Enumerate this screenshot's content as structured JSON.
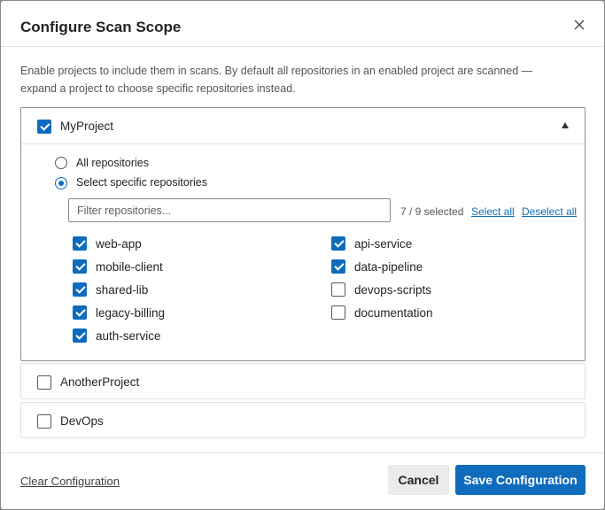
{
  "dialog": {
    "title": "Configure Scan Scope",
    "description": "Enable projects to include them in scans. By default all repositories in an enabled project are scanned — expand a project to choose specific repositories instead."
  },
  "projects": [
    {
      "name": "MyProject",
      "checked": true,
      "expanded": true,
      "scope_options": {
        "all_label": "All repositories",
        "specific_label": "Select specific repositories",
        "selected": "specific"
      },
      "filter_placeholder": "Filter repositories...",
      "selected_count": "7 / 9 selected",
      "select_all_label": "Select all",
      "deselect_all_label": "Deselect all",
      "repositories": [
        {
          "name": "web-app",
          "checked": true
        },
        {
          "name": "api-service",
          "checked": true
        },
        {
          "name": "mobile-client",
          "checked": true
        },
        {
          "name": "data-pipeline",
          "checked": true
        },
        {
          "name": "shared-lib",
          "checked": true
        },
        {
          "name": "devops-scripts",
          "checked": false
        },
        {
          "name": "legacy-billing",
          "checked": true
        },
        {
          "name": "documentation",
          "checked": false
        },
        {
          "name": "auth-service",
          "checked": true
        }
      ]
    },
    {
      "name": "AnotherProject",
      "checked": false,
      "expanded": false
    },
    {
      "name": "DevOps",
      "checked": false,
      "expanded": false
    }
  ],
  "footer": {
    "clear_label": "Clear Configuration",
    "cancel_label": "Cancel",
    "save_label": "Save Configuration"
  },
  "colors": {
    "accent": "#0f6cbd",
    "cancel_bg": "#ebebeb"
  },
  "icons": {
    "close": "close-icon",
    "collapse": "caret-up-icon"
  }
}
